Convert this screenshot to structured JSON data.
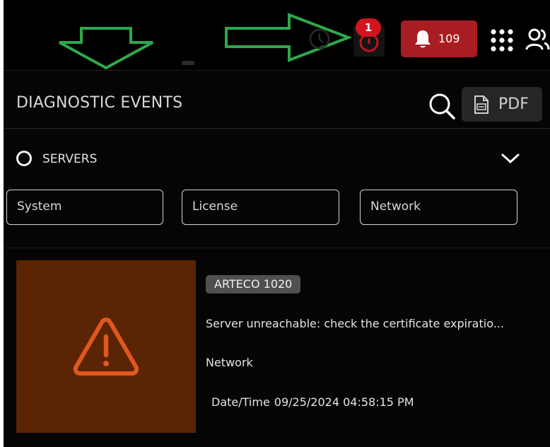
{
  "header": {
    "diagnostics_badge_count": "1",
    "notifications_count": "109"
  },
  "panel": {
    "title": "DIAGNOSTIC EVENTS",
    "pdf_label": "PDF"
  },
  "servers": {
    "label": "SERVERS"
  },
  "filters": [
    {
      "label": "System"
    },
    {
      "label": "License"
    },
    {
      "label": "Network"
    }
  ],
  "event": {
    "server_tag": "ARTECO 1020",
    "message": "Server unreachable: check the certificate expiratio...",
    "category": "Network",
    "datetime_label": "Date/Time",
    "datetime_value": "09/25/2024 04:58:15 PM"
  },
  "colors": {
    "background": "#050505",
    "notification_red": "#a81d22",
    "badge_red": "#d2141e",
    "thumbnail_brown": "#5a2405",
    "warning_orange": "#e0581d",
    "annotation_green": "#2fa84a",
    "tag_gray": "#505050"
  },
  "icons": {
    "search": "search-icon",
    "pdf": "pdf-file-icon",
    "chevron": "chevron-down-icon",
    "warning": "warning-triangle-icon",
    "bell": "bell-icon",
    "apps": "apps-grid-icon",
    "users": "users-icon"
  }
}
